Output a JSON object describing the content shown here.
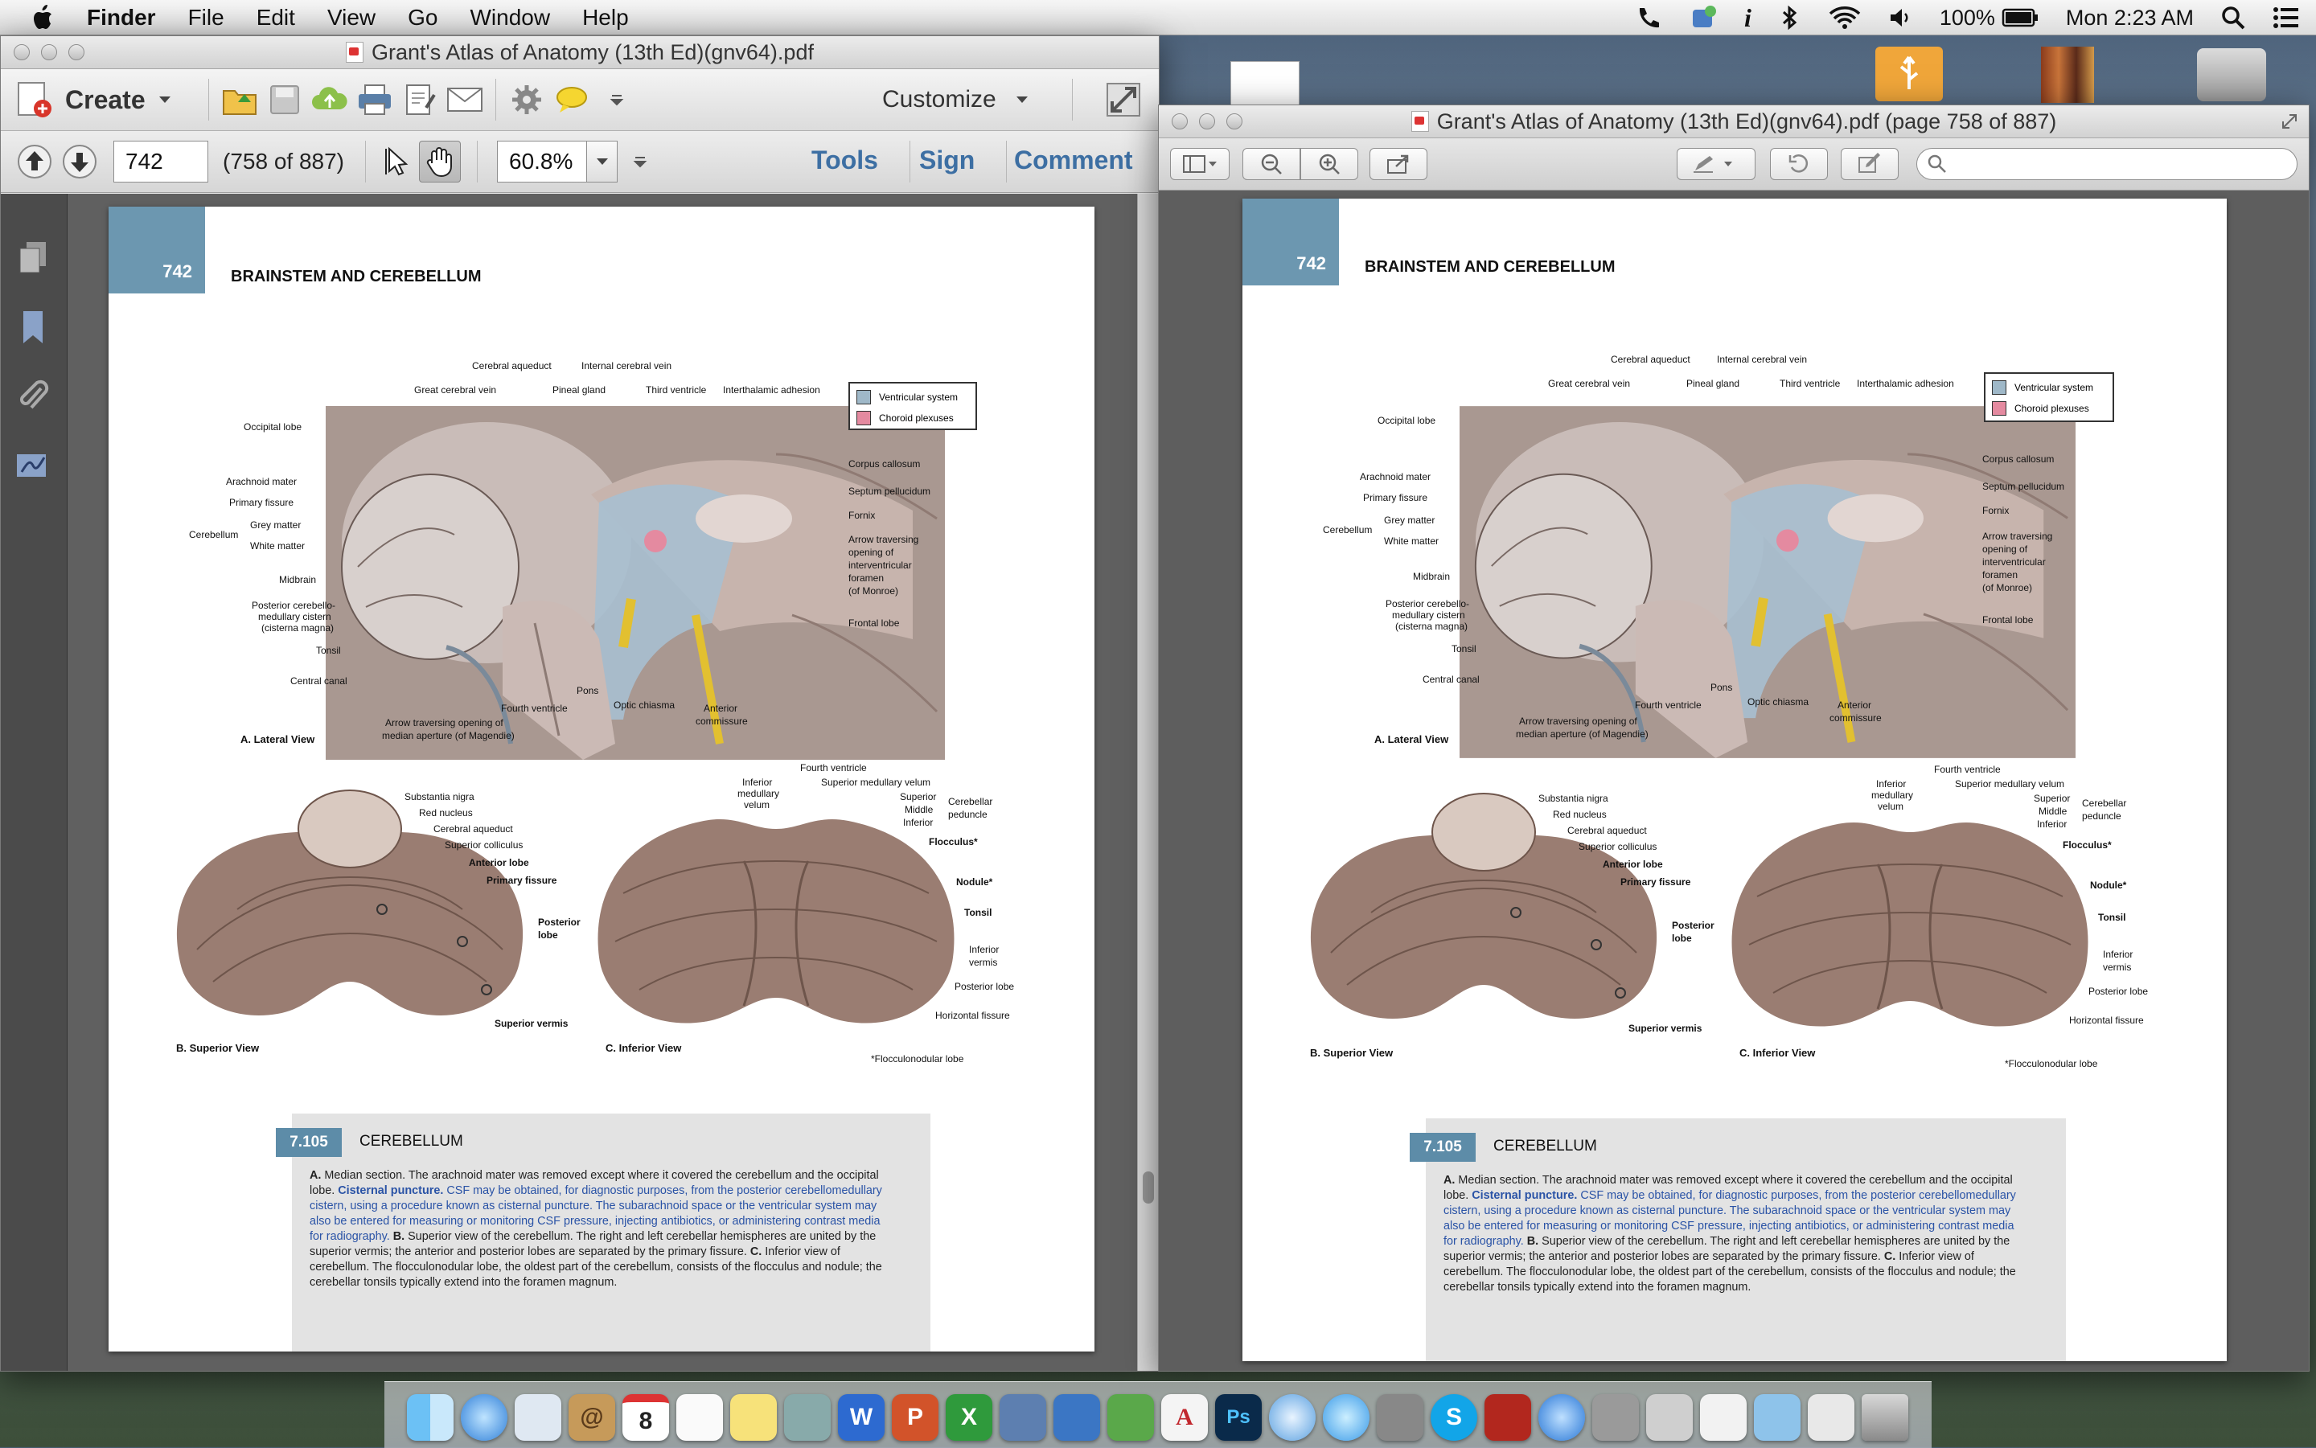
{
  "menubar": {
    "app": "Finder",
    "items": [
      "File",
      "Edit",
      "View",
      "Go",
      "Window",
      "Help"
    ],
    "battery": "100%",
    "clock": "Mon 2:23 AM"
  },
  "acrobat": {
    "title": "Grant's Atlas of Anatomy (13th Ed)(gnv64).pdf",
    "create_label": "Create",
    "customize_label": "Customize",
    "page_input": "742",
    "page_of": "(758 of 887)",
    "zoom": "60.8%",
    "tools_label": "Tools",
    "sign_label": "Sign",
    "comment_label": "Comment"
  },
  "preview": {
    "title": "Grant's Atlas of Anatomy (13th Ed)(gnv64).pdf (page 758 of 887)"
  },
  "page": {
    "number": "742",
    "chapter": "BRAINSTEM AND CEREBELLUM",
    "legend": [
      {
        "label": "Ventricular system",
        "color": "#9fb8c8"
      },
      {
        "label": "Choroid plexuses",
        "color": "#e48aa0"
      }
    ],
    "panel_a_title": "A. Lateral View",
    "panel_b_title": "B. Superior View",
    "panel_c_title": "C. Inferior View",
    "footnote": "*Flocculonodular lobe",
    "labels_a_top": [
      "Cerebral aqueduct",
      "Internal cerebral vein",
      "Great cerebral vein",
      "Pineal gland",
      "Third ventricle",
      "Interthalamic adhesion"
    ],
    "labels_a_left": [
      "Occipital lobe",
      "Arachnoid mater",
      "Primary fissure",
      "Grey matter",
      "Cerebellum",
      "White matter",
      "Midbrain",
      "Posterior cerebello-",
      "medullary cistern",
      "(cisterna magna)",
      "Tonsil",
      "Central canal"
    ],
    "labels_a_right": [
      "Corpus callosum",
      "Septum pellucidum",
      "Fornix",
      "Arrow traversing",
      "opening of",
      "interventricular",
      "foramen",
      "(of Monroe)",
      "Frontal lobe"
    ],
    "labels_a_bottom": [
      "Fourth ventricle",
      "Pons",
      "Optic chiasma",
      "Anterior",
      "commissure",
      "Arrow traversing opening of",
      "median aperture (of Magendie)"
    ],
    "labels_b": [
      "Substantia nigra",
      "Red nucleus",
      "Cerebral aqueduct",
      "Superior colliculus",
      "Anterior lobe",
      "Primary fissure",
      "Posterior",
      "lobe",
      "Superior vermis"
    ],
    "labels_c": [
      "Fourth ventricle",
      "Inferior",
      "medullary",
      "velum",
      "Superior medullary velum",
      "Superior",
      "Middle",
      "Inferior",
      "Cerebellar",
      "peduncle",
      "Flocculus*",
      "Nodule*",
      "Tonsil",
      "Inferior",
      "vermis",
      "Posterior lobe",
      "Horizontal fissure"
    ],
    "caption_badge": "7.105",
    "caption_title": "CEREBELLUM",
    "caption_1": "A. ",
    "caption_2": "Median section. The arachnoid mater was removed except where it covered the cerebellum and the occipital lobe. ",
    "caption_3": "Cisternal puncture. ",
    "caption_4": "CSF may be obtained, for diagnostic purposes, from the posterior cerebellomedullary cistern, using a procedure known as cisternal puncture. The subarachnoid space or the ventricular system may also be entered for measuring or monitoring CSF pressure, injecting antibiotics, or administering contrast media for radiography. ",
    "caption_5": "B. ",
    "caption_6": "Superior view of the cerebellum. The right and left cerebellar hemispheres are united by the superior vermis; the anterior and posterior lobes are separated by the primary fissure. ",
    "caption_7": "C. ",
    "caption_8": "Inferior view of cerebellum. The flocculonodular lobe, the oldest part of the cerebellum, consists of the flocculus and nodule; the cerebellar tonsils typically extend into the foramen magnum."
  },
  "dock": {
    "word": "W",
    "ppt": "P",
    "excel": "X",
    "ps": "Ps",
    "skype": "S",
    "calendar_day": "8"
  }
}
